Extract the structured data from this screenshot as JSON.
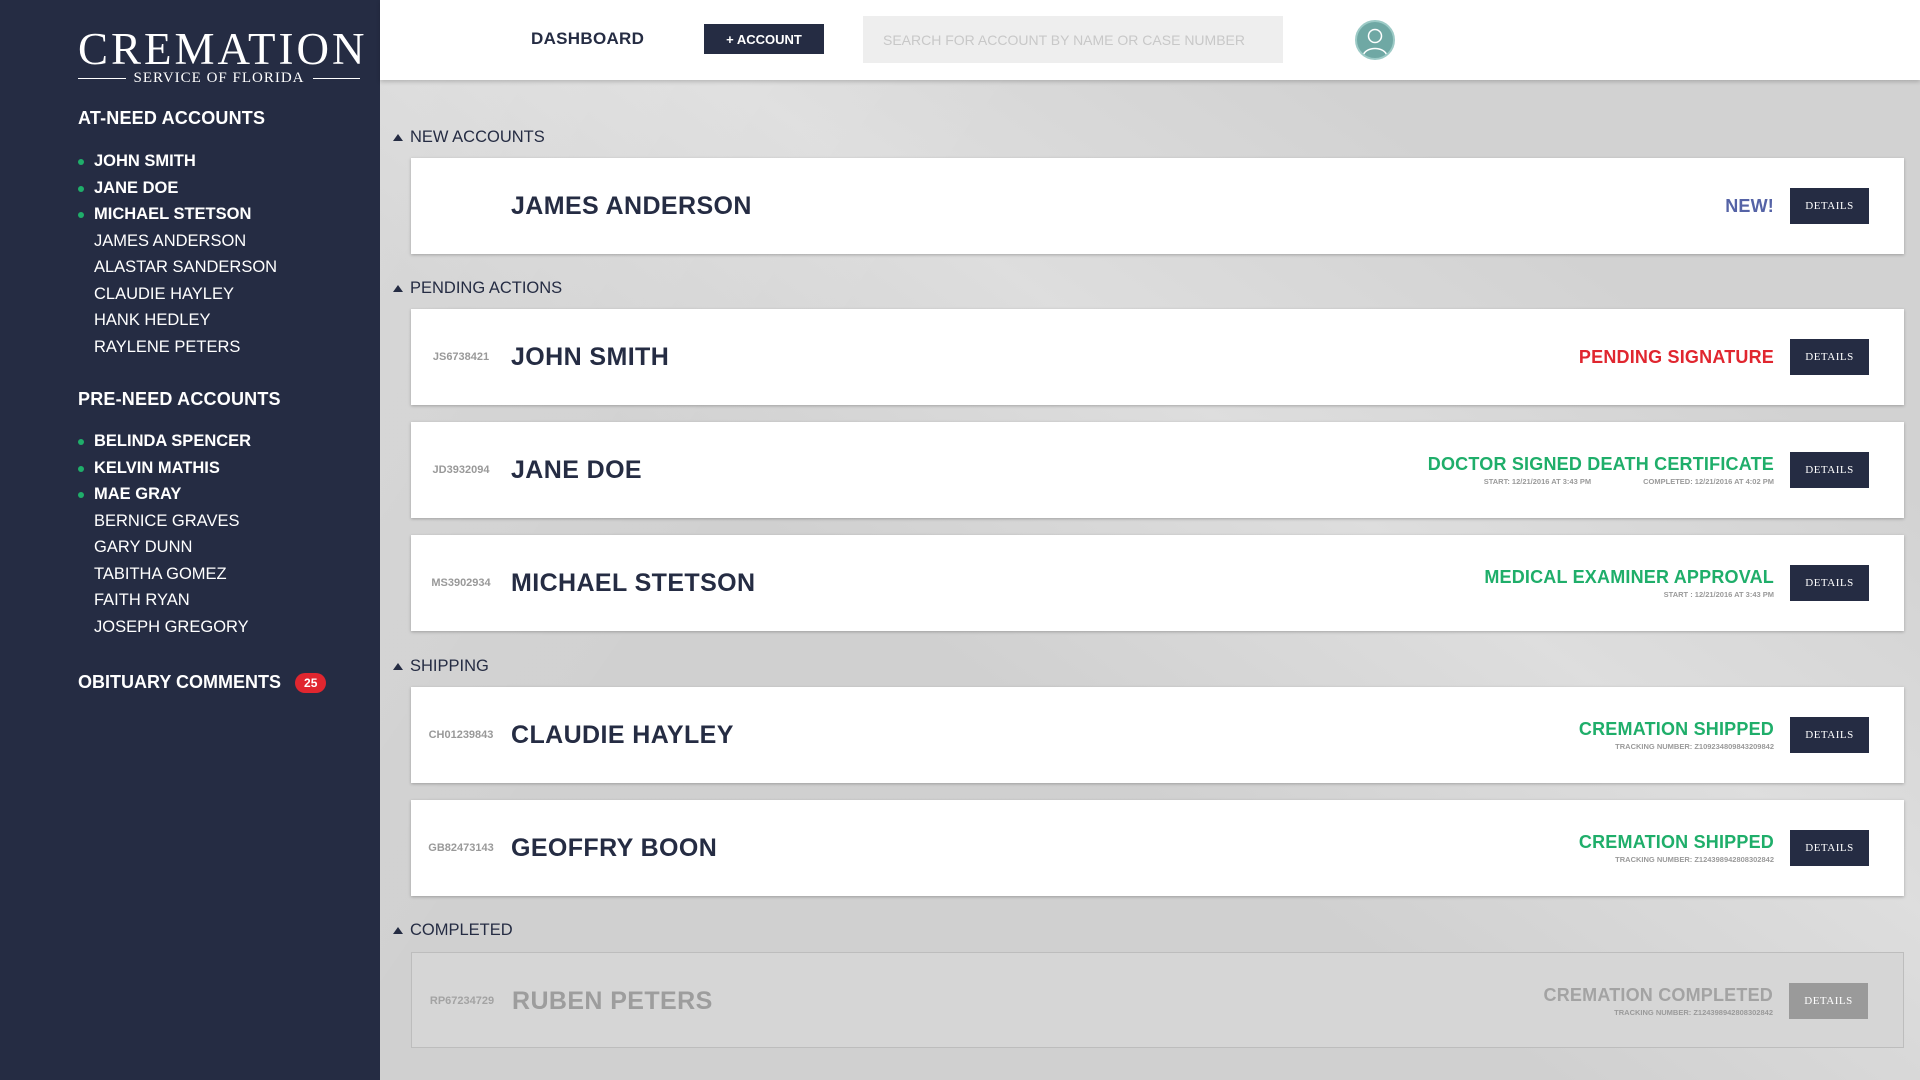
{
  "brand": {
    "name": "CREMATION",
    "subtitle": "SERVICE OF FLORIDA"
  },
  "topbar": {
    "dashboard_label": "DASHBOARD",
    "add_account_label": "+ ACCOUNT",
    "search_placeholder": "SEARCH FOR ACCOUNT BY NAME OR CASE NUMBER"
  },
  "sidebar": {
    "at_need_title": "AT-NEED ACCOUNTS",
    "at_need": [
      {
        "label": "JOHN SMITH",
        "active": true
      },
      {
        "label": "JANE DOE",
        "active": true
      },
      {
        "label": "MICHAEL STETSON",
        "active": true
      },
      {
        "label": "JAMES ANDERSON",
        "active": false
      },
      {
        "label": "ALASTAR SANDERSON",
        "active": false
      },
      {
        "label": "CLAUDIE HAYLEY",
        "active": false
      },
      {
        "label": "HANK HEDLEY",
        "active": false
      },
      {
        "label": "RAYLENE PETERS",
        "active": false
      }
    ],
    "pre_need_title": "PRE-NEED ACCOUNTS",
    "pre_need": [
      {
        "label": "BELINDA SPENCER",
        "active": true
      },
      {
        "label": "KELVIN MATHIS",
        "active": true
      },
      {
        "label": "MAE GRAY",
        "active": true
      },
      {
        "label": "BERNICE GRAVES",
        "active": false
      },
      {
        "label": "GARY DUNN",
        "active": false
      },
      {
        "label": "TABITHA GOMEZ",
        "active": false
      },
      {
        "label": "FAITH RYAN",
        "active": false
      },
      {
        "label": "JOSEPH GREGORY",
        "active": false
      }
    ],
    "obituary_label": "OBITUARY COMMENTS",
    "obituary_count": "25"
  },
  "colors": {
    "navy": "#252c43",
    "green": "#1fae6a",
    "red": "#e0262f",
    "blue": "#5563a6",
    "grey": "#9d9d9d"
  },
  "groups": {
    "new_accounts": "NEW ACCOUNTS",
    "pending_actions": "PENDING ACTIONS",
    "shipping": "SHIPPING",
    "completed": "COMPLETED"
  },
  "details_label": "DETAILS",
  "cards": [
    {
      "case": "",
      "name": "JAMES ANDERSON",
      "status": "NEW!",
      "status_color": "#5563a6"
    },
    {
      "case": "JS6738421",
      "name": "JOHN SMITH",
      "status": "PENDING SIGNATURE",
      "status_color": "#e0262f"
    },
    {
      "case": "JD3932094",
      "name": "JANE DOE",
      "status": "DOCTOR SIGNED DEATH CERTIFICATE",
      "status_color": "#1fae6a",
      "sub_left": "START: 12/21/2016 AT 3:43 PM",
      "sub_right": "COMPLETED: 12/21/2016 AT 4:02 PM"
    },
    {
      "case": "MS3902934",
      "name": "MICHAEL STETSON",
      "status": "MEDICAL EXAMINER APPROVAL",
      "status_color": "#1fae6a",
      "sub": "START : 12/21/2016 AT 3:43 PM"
    },
    {
      "case": "CH01239843",
      "name": "CLAUDIE HAYLEY",
      "status": "CREMATION SHIPPED",
      "status_color": "#1fae6a",
      "sub": "TRACKING NUMBER: Z109234809843209842"
    },
    {
      "case": "GB82473143",
      "name": "GEOFFRY BOON",
      "status": "CREMATION SHIPPED",
      "status_color": "#1fae6a",
      "sub": "TRACKING NUMBER: Z124398942808302842"
    },
    {
      "case": "RP67234729",
      "name": "RUBEN PETERS",
      "status": "CREMATION COMPLETED",
      "status_color": "#a3a3a3",
      "sub": "TRACKING NUMBER: Z124398942808302842"
    }
  ]
}
